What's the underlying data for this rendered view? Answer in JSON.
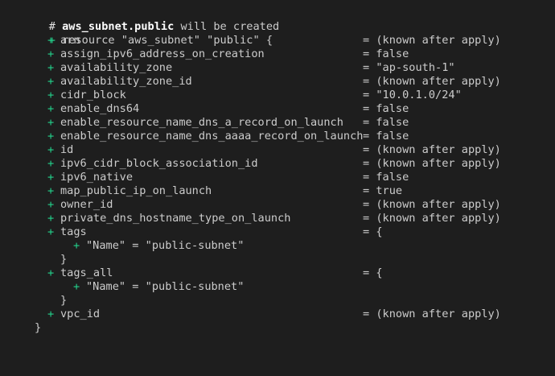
{
  "header": {
    "hash": "#",
    "resource_address": "aws_subnet.public",
    "suffix": "will be created"
  },
  "resource_line": {
    "plus": "+",
    "text": "resource \"aws_subnet\" \"public\" {"
  },
  "attributes": [
    {
      "plus": "+",
      "name": "arn",
      "value": "= (known after apply)"
    },
    {
      "plus": "+",
      "name": "assign_ipv6_address_on_creation",
      "value": "= false"
    },
    {
      "plus": "+",
      "name": "availability_zone",
      "value": "= \"ap-south-1\""
    },
    {
      "plus": "+",
      "name": "availability_zone_id",
      "value": "= (known after apply)"
    },
    {
      "plus": "+",
      "name": "cidr_block",
      "value": "= \"10.0.1.0/24\""
    },
    {
      "plus": "+",
      "name": "enable_dns64",
      "value": "= false"
    },
    {
      "plus": "+",
      "name": "enable_resource_name_dns_a_record_on_launch",
      "value": "= false"
    },
    {
      "plus": "+",
      "name": "enable_resource_name_dns_aaaa_record_on_launch",
      "value": "= false"
    },
    {
      "plus": "+",
      "name": "id",
      "value": "= (known after apply)"
    },
    {
      "plus": "+",
      "name": "ipv6_cidr_block_association_id",
      "value": "= (known after apply)"
    },
    {
      "plus": "+",
      "name": "ipv6_native",
      "value": "= false"
    },
    {
      "plus": "+",
      "name": "map_public_ip_on_launch",
      "value": "= true"
    },
    {
      "plus": "+",
      "name": "owner_id",
      "value": "= (known after apply)"
    },
    {
      "plus": "+",
      "name": "private_dns_hostname_type_on_launch",
      "value": "= (known after apply)"
    }
  ],
  "tags": {
    "plus": "+",
    "name": "tags",
    "value": "= {",
    "entry_plus": "+",
    "entry": "\"Name\" = \"public-subnet\"",
    "close": "}"
  },
  "tags_all": {
    "plus": "+",
    "name": "tags_all",
    "value": "= {",
    "entry_plus": "+",
    "entry": "\"Name\" = \"public-subnet\"",
    "close": "}"
  },
  "vpc_id": {
    "plus": "+",
    "name": "vpc_id",
    "value": "= (known after apply)"
  },
  "resource_close": "}",
  "colors": {
    "background": "#1e1e1e",
    "text": "#cccccc",
    "plus_green": "#23d18b",
    "header_bold": "#ffffff"
  }
}
